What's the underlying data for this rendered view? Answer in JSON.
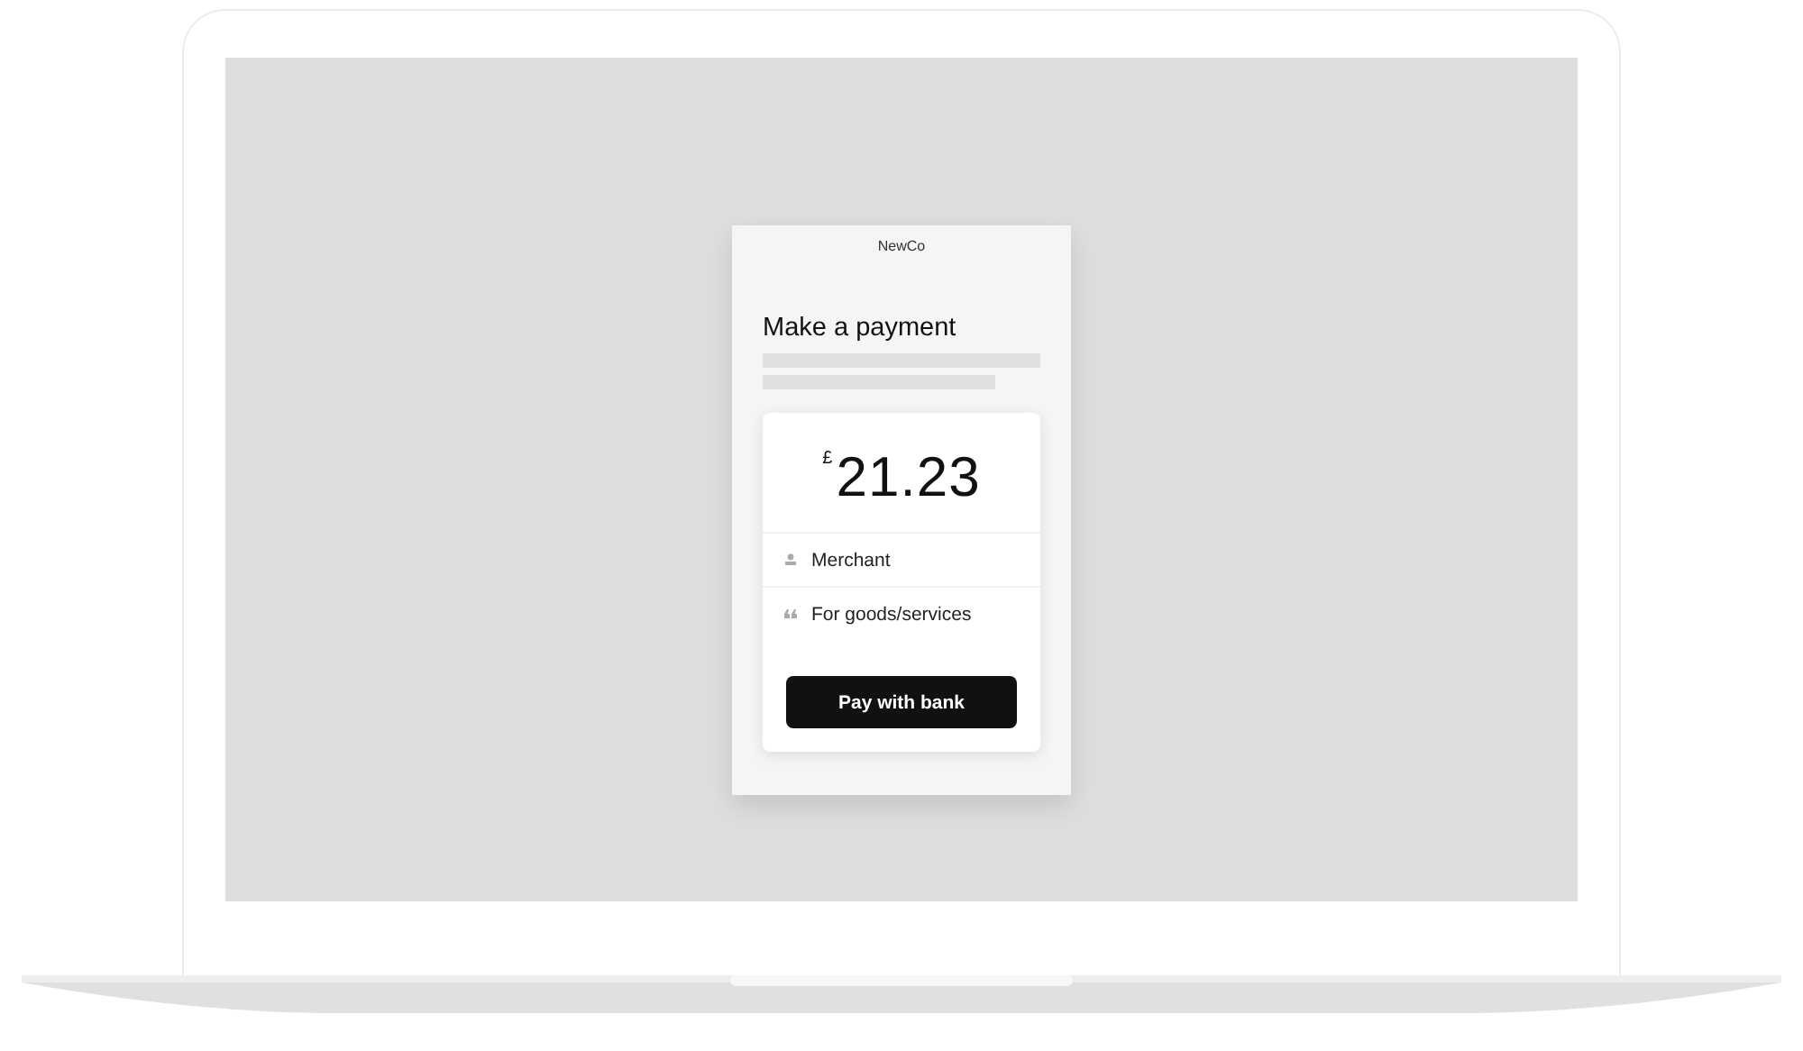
{
  "checkout": {
    "brand": "NewCo",
    "title": "Make a payment",
    "amount": {
      "currency": "£",
      "value": "21.23"
    },
    "details": [
      {
        "kind": "payee",
        "text": "Merchant"
      },
      {
        "kind": "reference",
        "text": "For goods/services"
      }
    ],
    "button": "Pay with bank"
  }
}
